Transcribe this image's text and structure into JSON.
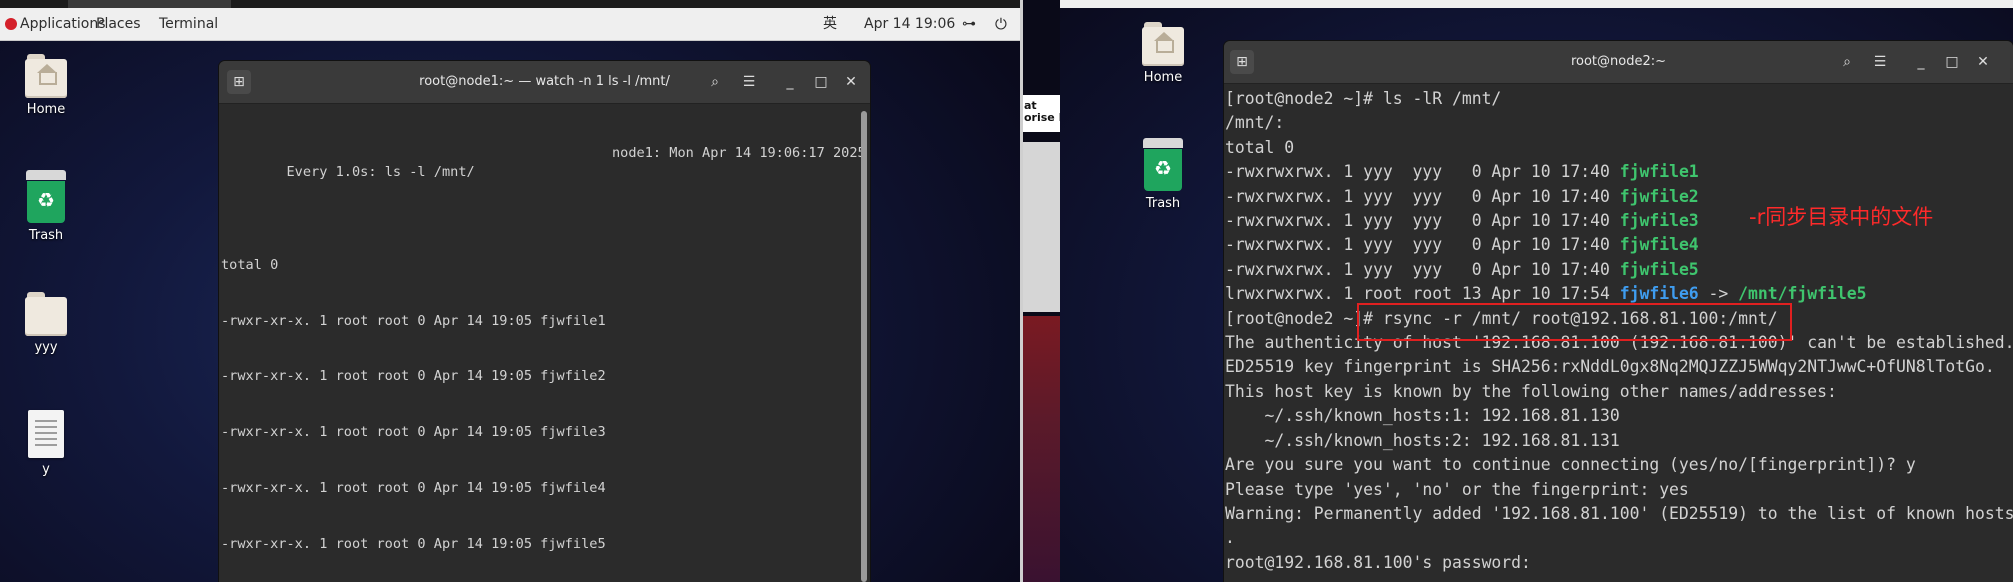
{
  "left_panel": {
    "applications": "Applications",
    "places": "Places",
    "terminal": "Terminal",
    "ime": "英",
    "clock": "Apr 14  19:06"
  },
  "left_desktop": {
    "icons": [
      {
        "label": "Home"
      },
      {
        "label": "Trash"
      },
      {
        "label": "yyy"
      },
      {
        "label": "y"
      }
    ]
  },
  "term1": {
    "title": "root@node1:~ — watch -n 1 ls -l /mnt/",
    "header_left": "Every 1.0s: ls -l /mnt/",
    "header_right": "node1: Mon Apr 14 19:06:17 2025",
    "lines": [
      "total 0",
      "-rwxr-xr-x. 1 root root 0 Apr 14 19:05 fjwfile1",
      "-rwxr-xr-x. 1 root root 0 Apr 14 19:05 fjwfile2",
      "-rwxr-xr-x. 1 root root 0 Apr 14 19:05 fjwfile3",
      "-rwxr-xr-x. 1 root root 0 Apr 14 19:05 fjwfile4",
      "-rwxr-xr-x. 1 root root 0 Apr 14 19:05 fjwfile5"
    ]
  },
  "mid_strip": {
    "text": "at\norise Li"
  },
  "right_desktop": {
    "icons": [
      {
        "label": "Home"
      },
      {
        "label": "Trash"
      }
    ]
  },
  "term2": {
    "title": "root@node2:~",
    "lines": [
      {
        "pre": "[root@node2 ~]# ls -lR /mnt/"
      },
      {
        "pre": "/mnt/:"
      },
      {
        "pre": "total 0"
      },
      {
        "pre": "-rwxrwxrwx. 1 yyy  yyy   0 Apr 10 17:40 ",
        "green": "fjwfile1"
      },
      {
        "pre": "-rwxrwxrwx. 1 yyy  yyy   0 Apr 10 17:40 ",
        "green": "fjwfile2"
      },
      {
        "pre": "-rwxrwxrwx. 1 yyy  yyy   0 Apr 10 17:40 ",
        "green": "fjwfile3"
      },
      {
        "pre": "-rwxrwxrwx. 1 yyy  yyy   0 Apr 10 17:40 ",
        "green": "fjwfile4"
      },
      {
        "pre": "-rwxrwxrwx. 1 yyy  yyy   0 Apr 10 17:40 ",
        "green": "fjwfile5"
      },
      {
        "pre": "lrwxrwxrwx. 1 root root 13 Apr 10 17:54 ",
        "blue": "fjwfile6",
        "mid": " -> ",
        "green": "/mnt/fjwfile5"
      },
      {
        "pre": "[root@node2 ~]# rsync -r /mnt/ root@192.168.81.100:/mnt/"
      },
      {
        "pre": "The authenticity of host '192.168.81.100 (192.168.81.100)' can't be established."
      },
      {
        "pre": "ED25519 key fingerprint is SHA256:rxNddL0gx8Nq2MQJZZJ5WWqy2NTJwwC+OfUN8lTotGo."
      },
      {
        "pre": "This host key is known by the following other names/addresses:"
      },
      {
        "pre": "    ~/.ssh/known_hosts:1: 192.168.81.130"
      },
      {
        "pre": "    ~/.ssh/known_hosts:2: 192.168.81.131"
      },
      {
        "pre": "Are you sure you want to continue connecting (yes/no/[fingerprint])? y"
      },
      {
        "pre": "Please type 'yes', 'no' or the fingerprint: yes"
      },
      {
        "pre": "Warning: Permanently added '192.168.81.100' (ED25519) to the list of known hosts"
      },
      {
        "pre": "."
      },
      {
        "pre": "root@192.168.81.100's password: "
      }
    ]
  },
  "annotation": {
    "text": "-r同步目录中的文件",
    "color": "#ff2a2a"
  },
  "colors": {
    "terminal_bg": "#2b2b2b",
    "file_green": "#3fc56e",
    "link_blue": "#3f9df0",
    "highlight_box": "#e02020"
  }
}
